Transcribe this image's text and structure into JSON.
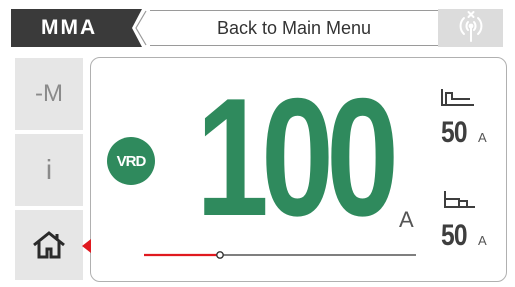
{
  "header": {
    "mode_label": "MMA",
    "title": "Back to Main Menu",
    "wireless_icon": "wireless-disconnected-icon"
  },
  "side_buttons": {
    "memory_label": "-M",
    "info_label": "i",
    "home_icon": "home-icon"
  },
  "main": {
    "vrd_label": "VRD",
    "current_value": "100",
    "current_unit": "A",
    "slider_level": 0.28,
    "hot_start": {
      "icon": "hot-start-icon",
      "value": "50",
      "unit": "A"
    },
    "arc_force": {
      "icon": "arc-force-icon",
      "value": "50",
      "unit": "A"
    }
  },
  "colors": {
    "accent_green": "#2f8a5d",
    "header_dark": "#3a3a3a",
    "slider_active": "#e0191f",
    "selection_marker": "#e0191f"
  }
}
